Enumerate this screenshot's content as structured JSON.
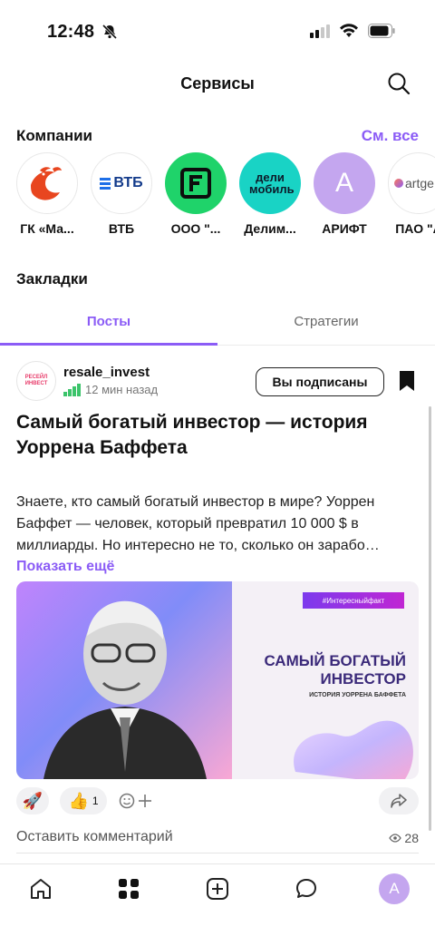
{
  "status": {
    "time": "12:48"
  },
  "header": {
    "title": "Сервисы"
  },
  "companies_section": {
    "title": "Компании",
    "see_all": "См. все"
  },
  "companies": [
    {
      "name": "ГК «Ма...",
      "icon": "birds-logo-icon",
      "bg": "#ffffff"
    },
    {
      "name": "ВТБ",
      "logo_text": "ВТБ",
      "icon": "vtb-logo-icon",
      "bg": "#ffffff"
    },
    {
      "name": "ООО \"...",
      "icon": "f-logo-icon",
      "bg": "#1fd36a"
    },
    {
      "name": "Делим...",
      "logo_text": "дели мобиль",
      "icon": "delimobil-logo-icon",
      "bg": "#19d3c5"
    },
    {
      "name": "АРИФТ",
      "logo_text": "А",
      "icon": "letter-avatar-icon",
      "bg": "#c4a6ef"
    },
    {
      "name": "ПАО \"А",
      "logo_text": "artge",
      "icon": "artgen-logo-icon",
      "bg": "#ffffff"
    }
  ],
  "bookmarks": {
    "title": "Закладки"
  },
  "tabs": [
    {
      "label": "Посты",
      "active": true
    },
    {
      "label": "Стратегии",
      "active": false
    }
  ],
  "post": {
    "author": "resale_invest",
    "avatar_text": "РЕСЕЙЛ ИНВЕСТ",
    "time": "12 мин назад",
    "subscribe_label": "Вы подписаны",
    "title": "Самый богатый инвестор — история Уоррена Баффета",
    "body": "Знаете, кто самый богатый инвестор в мире? Уоррен Баффет — человек, который превратил 10 000 $ в миллиарды. Но интересно не то, сколько он зарабо…",
    "show_more": "Показать ещё",
    "image": {
      "tag": "#Интересныйфакт",
      "headline": "САМЫЙ БОГАТЫЙ ИНВЕСТОР",
      "subheadline": "ИСТОРИЯ УОРРЕНА БАФФЕТА"
    },
    "reactions": [
      {
        "emoji": "🚀",
        "count": ""
      },
      {
        "emoji": "👍",
        "count": "1"
      }
    ],
    "comment_placeholder": "Оставить комментарий",
    "views": "28"
  },
  "colors": {
    "accent": "#8b5cf6"
  },
  "bottom_nav": {
    "items": [
      "home-icon",
      "services-icon",
      "add-icon",
      "chat-icon"
    ],
    "avatar_letter": "А"
  }
}
